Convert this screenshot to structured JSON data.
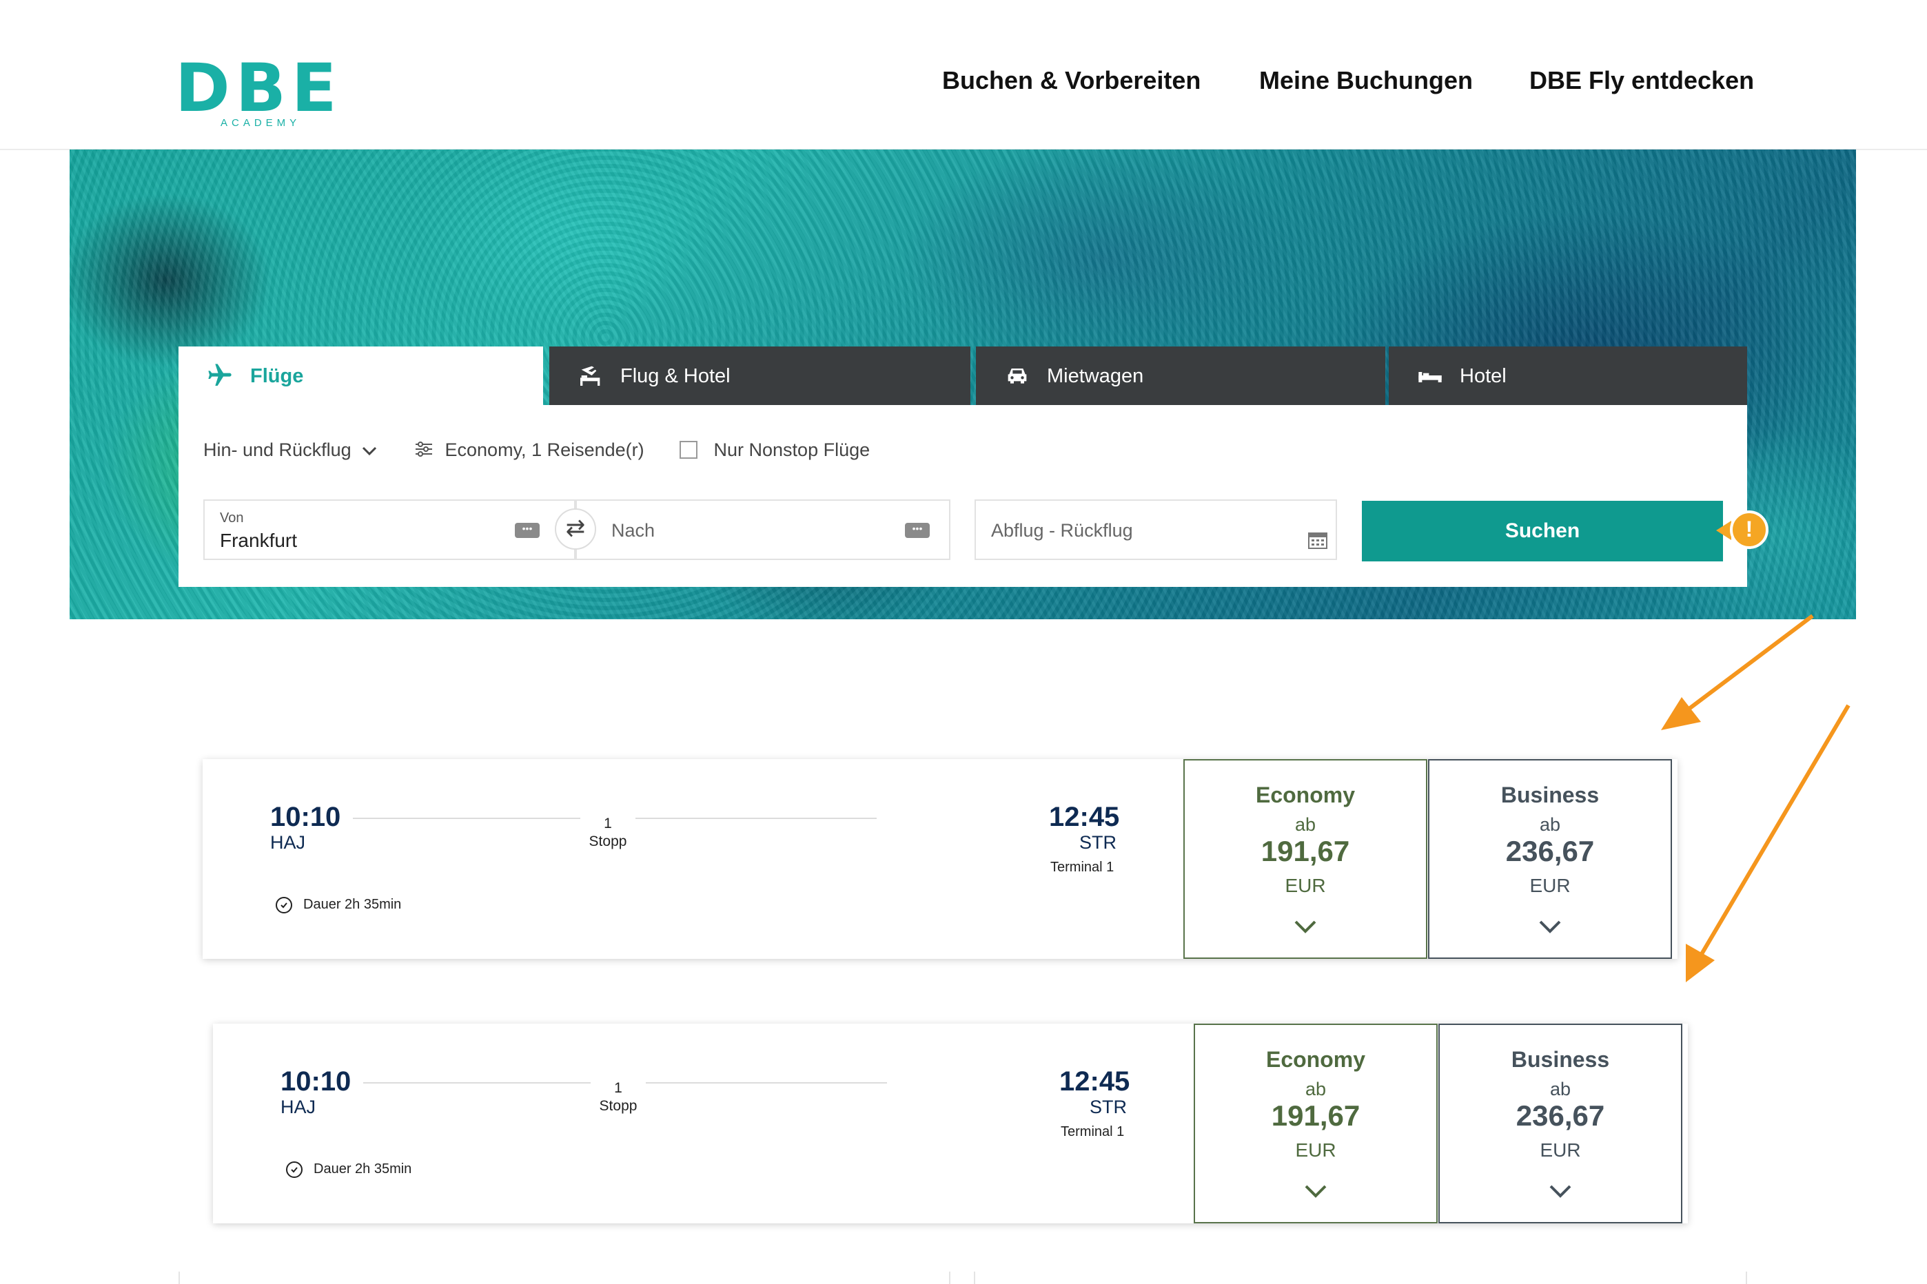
{
  "header": {
    "logo_text": "DBE",
    "logo_subtext": "ACADEMY",
    "nav": [
      "Buchen & Vorbereiten",
      "Meine Buchungen",
      "DBE Fly entdecken"
    ]
  },
  "search": {
    "tabs": [
      {
        "label": "Flüge",
        "icon": "plane-icon",
        "active": true
      },
      {
        "label": "Flug & Hotel",
        "icon": "flight-hotel-icon",
        "active": false
      },
      {
        "label": "Mietwagen",
        "icon": "car-icon",
        "active": false
      },
      {
        "label": "Hotel",
        "icon": "bed-icon",
        "active": false
      }
    ],
    "trip_type": "Hin- und Rückflug",
    "cabin_passengers": "Economy, 1 Reisende(r)",
    "nonstop_label": "Nur Nonstop Flüge",
    "nonstop_checked": false,
    "from_label": "Von",
    "from_value": "Frankfurt",
    "to_placeholder": "Nach",
    "dates_placeholder": "Abflug - Rückflug",
    "search_button": "Suchen",
    "warning_glyph": "!"
  },
  "flights": [
    {
      "dep_time": "10:10",
      "dep_airport": "HAJ",
      "stops_count": "1",
      "stops_label": "Stopp",
      "arr_time": "12:45",
      "arr_airport": "STR",
      "terminal": "Terminal 1",
      "duration": "Dauer 2h 35min",
      "fares": [
        {
          "class": "Economy",
          "from": "ab",
          "price": "191,67",
          "currency": "EUR"
        },
        {
          "class": "Business",
          "from": "ab",
          "price": "236,67",
          "currency": "EUR"
        }
      ]
    },
    {
      "dep_time": "10:10",
      "dep_airport": "HAJ",
      "stops_count": "1",
      "stops_label": "Stopp",
      "arr_time": "12:45",
      "arr_airport": "STR",
      "terminal": "Terminal 1",
      "duration": "Dauer 2h 35min",
      "fares": [
        {
          "class": "Economy",
          "from": "ab",
          "price": "191,67",
          "currency": "EUR"
        },
        {
          "class": "Business",
          "from": "ab",
          "price": "236,67",
          "currency": "EUR"
        }
      ]
    }
  ],
  "colors": {
    "brand": "#1ab0a6",
    "search_button": "#0f9a8f",
    "economy": "#4f6a3f",
    "business": "#46525c",
    "annotation": "#f5a623",
    "tab_dark": "#3a3d3f"
  }
}
